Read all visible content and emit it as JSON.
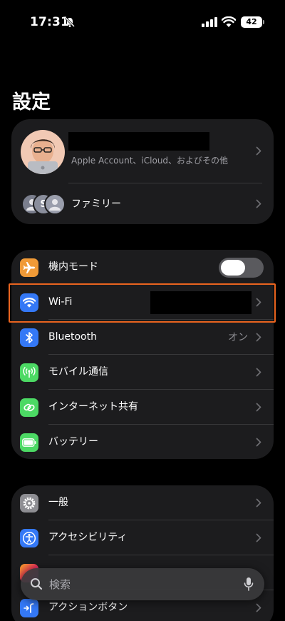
{
  "status_bar": {
    "time": "17:31",
    "battery": "42"
  },
  "page_title": "設定",
  "account": {
    "name": "",
    "subtitle": "Apple Account、iCloud、およびその他"
  },
  "family": {
    "label": "ファミリー",
    "member_initial": "S"
  },
  "connectivity": [
    {
      "id": "airplane",
      "label": "機内モード",
      "icon": "airplane-icon",
      "color": "#f09a37",
      "toggle": "off"
    },
    {
      "id": "wifi",
      "label": "Wi-Fi",
      "icon": "wifi-icon",
      "color": "#3478f6",
      "value": ""
    },
    {
      "id": "bluetooth",
      "label": "Bluetooth",
      "icon": "bluetooth-icon",
      "color": "#3478f6",
      "value": "オン"
    },
    {
      "id": "cellular",
      "label": "モバイル通信",
      "icon": "antenna-icon",
      "color": "#4cd964"
    },
    {
      "id": "hotspot",
      "label": "インターネット共有",
      "icon": "link-icon",
      "color": "#4cd964"
    },
    {
      "id": "battery",
      "label": "バッテリー",
      "icon": "battery-icon",
      "color": "#4cd964"
    }
  ],
  "general_group": [
    {
      "id": "general",
      "label": "一般",
      "icon": "gear-icon",
      "color": "#8e8e93"
    },
    {
      "id": "accessibility",
      "label": "アクセシビリティ",
      "icon": "accessibility-icon",
      "color": "#3478f6"
    },
    {
      "id": "action_button",
      "label": "アクションボタン",
      "icon": "action-button-icon",
      "color": "#3478f6"
    }
  ],
  "search": {
    "placeholder": "検索"
  },
  "highlight_color": "#e9641f"
}
